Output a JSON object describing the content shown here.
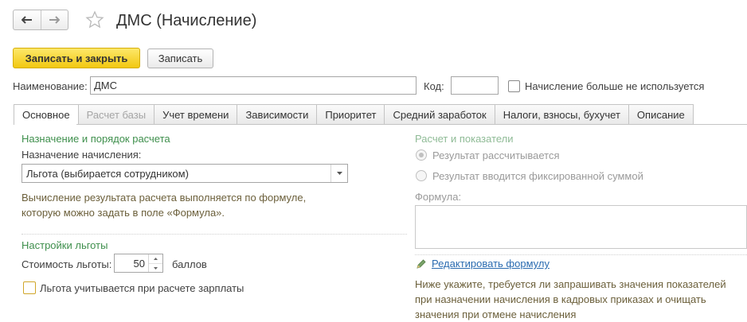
{
  "header": {
    "back_icon": "arrow-left-icon",
    "forward_icon": "arrow-right-icon",
    "favorite_icon": "star-icon",
    "title": "ДМС (Начисление)"
  },
  "toolbar": {
    "save_close_label": "Записать и закрыть",
    "save_label": "Записать"
  },
  "fields": {
    "name_label": "Наименование:",
    "name_value": "ДМС",
    "code_label": "Код:",
    "code_value": "",
    "unused_label": "Начисление больше не используется",
    "unused_checked": false
  },
  "tabs": [
    {
      "label": "Основное",
      "active": true,
      "disabled": false
    },
    {
      "label": "Расчет базы",
      "active": false,
      "disabled": true
    },
    {
      "label": "Учет времени",
      "active": false,
      "disabled": false
    },
    {
      "label": "Зависимости",
      "active": false,
      "disabled": false
    },
    {
      "label": "Приоритет",
      "active": false,
      "disabled": false
    },
    {
      "label": "Средний заработок",
      "active": false,
      "disabled": false
    },
    {
      "label": "Налоги, взносы, бухучет",
      "active": false,
      "disabled": false
    },
    {
      "label": "Описание",
      "active": false,
      "disabled": false
    }
  ],
  "left": {
    "purpose_section": "Назначение и порядок расчета",
    "purpose_label": "Назначение начисления:",
    "purpose_value": "Льгота (выбирается сотрудником)",
    "calc_note_1": "Вычисление результата расчета выполняется по формуле,",
    "calc_note_2": "которую можно задать в поле «Формула».",
    "benefit_section": "Настройки льготы",
    "cost_label": "Стоимость льготы:",
    "cost_value": "50",
    "cost_unit": "баллов",
    "payroll_label": "Льгота учитывается при расчете зарплаты",
    "payroll_checked": false
  },
  "right": {
    "calc_section": "Расчет и показатели",
    "radio_calculated": "Результат рассчитывается",
    "radio_fixed": "Результат вводится фиксированной суммой",
    "selected_radio": "calculated",
    "formula_label": "Формула:",
    "formula_value": "",
    "edit_formula_link": "Редактировать формулу",
    "bottom_note_1": "Ниже укажите, требуется ли запрашивать значения показателей",
    "bottom_note_2": "при назначении начисления в кадровых приказах и очищать",
    "bottom_note_3": "значения при отмене начисления"
  },
  "colors": {
    "primary_button": "#f2c811",
    "section_header": "#3e8f4c",
    "link": "#2a6bb0"
  }
}
